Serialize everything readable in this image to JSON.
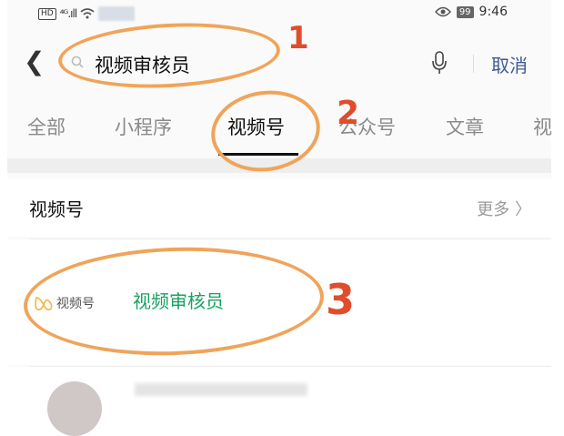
{
  "status_bar": {
    "network": "HD",
    "signal": "⁴ᴳ.ıll",
    "battery": "99",
    "time": "9:46"
  },
  "search": {
    "query": "视频审核员",
    "cancel_label": "取消"
  },
  "tabs": [
    {
      "label": "全部"
    },
    {
      "label": "小程序"
    },
    {
      "label": "视频号",
      "active": true
    },
    {
      "label": "公众号"
    },
    {
      "label": "文章"
    },
    {
      "label": "视"
    }
  ],
  "section": {
    "title": "视频号",
    "more_label": "更多 〉",
    "result": {
      "badge": "视频号",
      "name": "视频审核员"
    }
  },
  "annotations": [
    {
      "number": "1"
    },
    {
      "number": "2"
    },
    {
      "number": "3"
    }
  ],
  "colors": {
    "annotation_ring": "#f0a45a",
    "annotation_number": "#e04d2d",
    "channel_name": "#1aa260",
    "cancel": "#3c5a93"
  }
}
